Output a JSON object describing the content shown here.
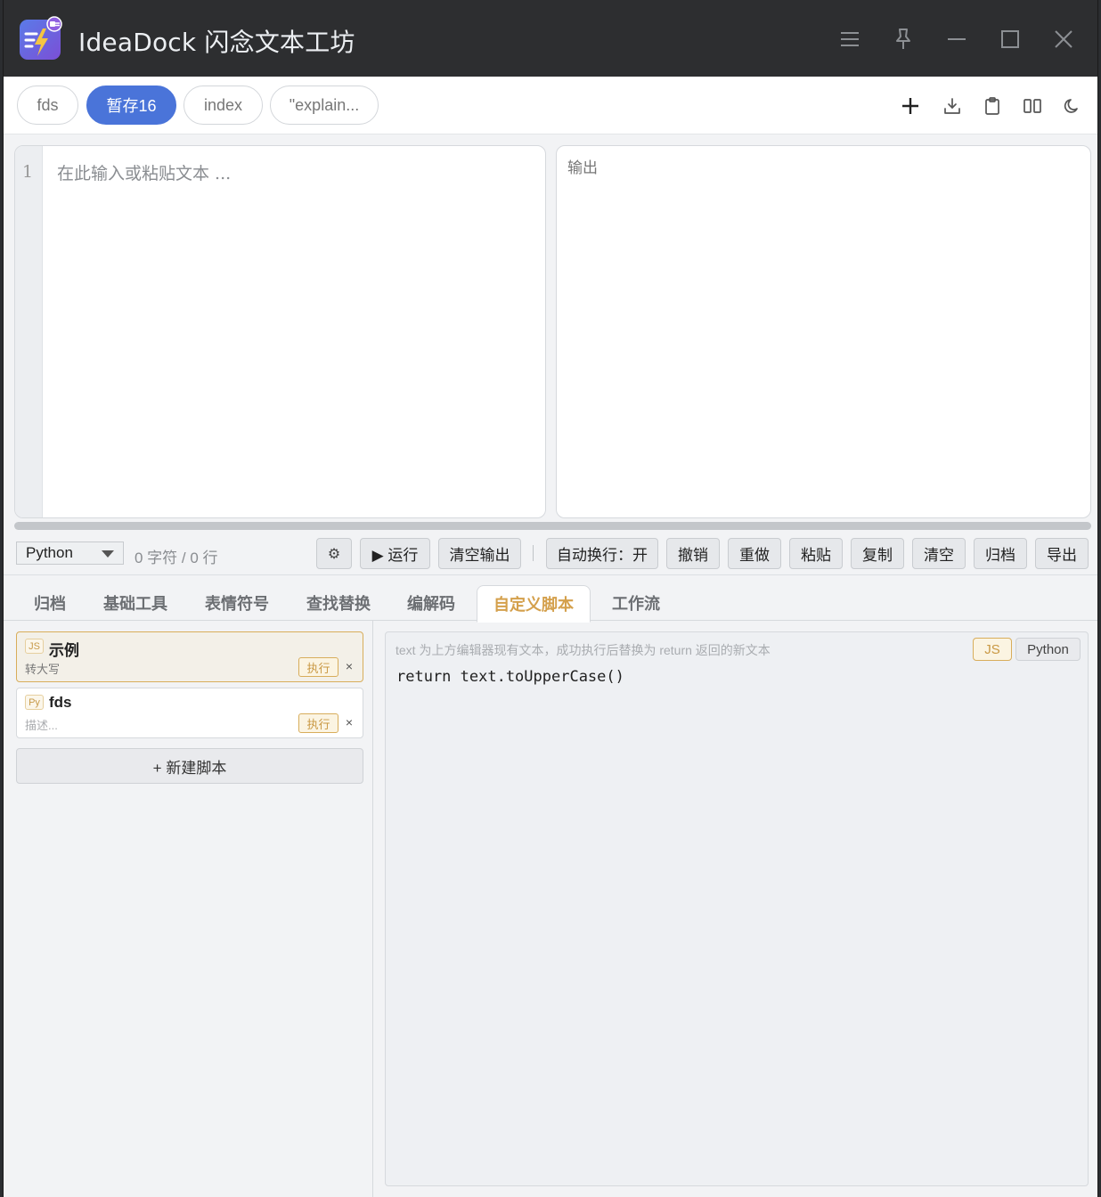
{
  "app": {
    "title": "IdeaDock 闪念文本工坊",
    "accent": "#4a74d9",
    "warm_accent": "#d4a04c"
  },
  "window_controls": [
    "menu-icon",
    "pin-icon",
    "minimize-icon",
    "maximize-icon",
    "close-icon"
  ],
  "tabs": [
    {
      "label": "fds",
      "active": false
    },
    {
      "label": "暂存16",
      "active": true
    },
    {
      "label": "index",
      "active": false
    },
    {
      "label": "\"explain...",
      "active": false
    }
  ],
  "toolbar_icons": [
    "plus-icon",
    "download-icon",
    "clipboard-icon",
    "split-view-icon",
    "moon-icon"
  ],
  "editor": {
    "line_number": "1",
    "placeholder": "在此输入或粘贴文本 ...",
    "output_placeholder": "输出"
  },
  "actions": {
    "language": "Python",
    "stats": "0 字符 / 0 行",
    "settings_glyph": "⚙",
    "run": "▶ 运行",
    "clear_output": "清空输出",
    "auto_wrap": "自动换行：开",
    "undo": "撤销",
    "redo": "重做",
    "paste": "粘贴",
    "copy": "复制",
    "clear": "清空",
    "archive": "归档",
    "export": "导出"
  },
  "bottom_tabs": [
    {
      "label": "归档",
      "active": false
    },
    {
      "label": "基础工具",
      "active": false
    },
    {
      "label": "表情符号",
      "active": false
    },
    {
      "label": "查找替换",
      "active": false
    },
    {
      "label": "编解码",
      "active": false
    },
    {
      "label": "自定义脚本",
      "active": true
    },
    {
      "label": "工作流",
      "active": false
    }
  ],
  "scripts": [
    {
      "lang": "JS",
      "name": "示例",
      "desc": "转大写",
      "exec": "执行",
      "delete": "×",
      "selected": true
    },
    {
      "lang": "Py",
      "name": "fds",
      "desc": "描述...",
      "exec": "执行",
      "delete": "×",
      "selected": false
    }
  ],
  "new_script": "+ 新建脚本",
  "code_panel": {
    "hint": "text 为上方编辑器现有文本，成功执行后替换为 return 返回的新文本",
    "lang_js": "JS",
    "lang_python": "Python",
    "code": "return text.toUpperCase()"
  }
}
